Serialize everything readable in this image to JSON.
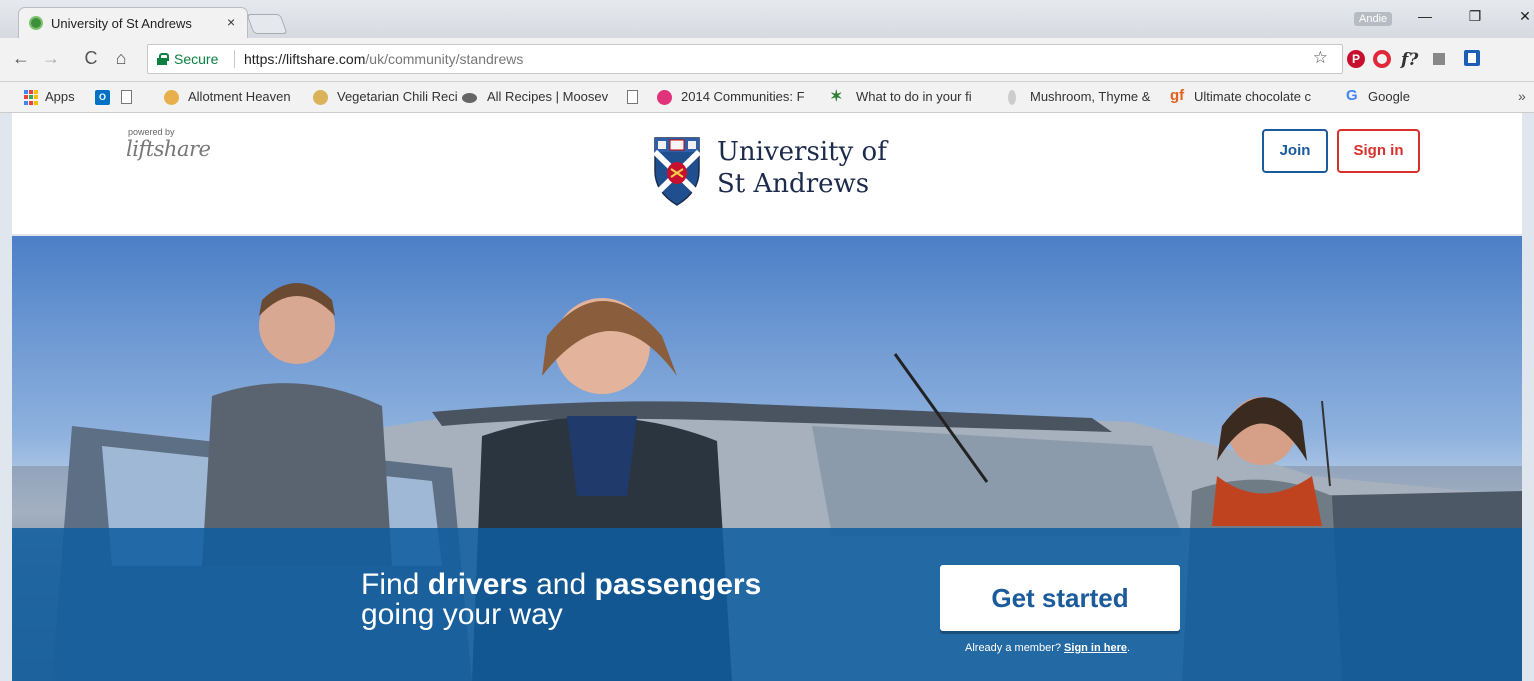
{
  "browser": {
    "tab": {
      "title": "University of St Andrews",
      "close": "×"
    },
    "profile": "Andie",
    "window_controls": {
      "minimize": "—",
      "restore": "❐",
      "close": "✕"
    },
    "nav": {
      "back": "←",
      "forward": "→",
      "reload": "C",
      "home": "⌂"
    },
    "omnibox": {
      "secure_label": "Secure",
      "url_host": "https://liftshare.com",
      "url_path": "/uk/community/standrews"
    },
    "bookmarks": [
      {
        "label": "Apps"
      },
      {
        "label": "Allotment Heaven"
      },
      {
        "label": "Vegetarian Chili Reci"
      },
      {
        "label": "All Recipes | Moosev"
      },
      {
        "label": "2014 Communities: F"
      },
      {
        "label": "What to do in your fi"
      },
      {
        "label": "Mushroom, Thyme &"
      },
      {
        "label": "Ultimate chocolate c"
      },
      {
        "label": "Google"
      }
    ],
    "bookmarks_more": "»",
    "extension_f_label": "f?",
    "bookmark_icon_text": {
      "outlook": "O",
      "gf": "gf",
      "google": "G"
    },
    "accent_colors": {
      "secure": "#0b8043",
      "pinterest": "#c8102e",
      "opera": "#e0283a"
    }
  },
  "header": {
    "powered_by": "powered by",
    "powered_logo": "liftshare",
    "university_line1": "University of",
    "university_line2": "St Andrews",
    "join_label": "Join",
    "signin_label": "Sign in"
  },
  "hero": {
    "tagline_find": "Find ",
    "tagline_drivers": "drivers",
    "tagline_and": " and ",
    "tagline_passengers": "passengers",
    "tagline_line2": "going your way",
    "cta_label": "Get started",
    "already_text": "Already a member? ",
    "signin_link": "Sign in here",
    "already_end": "."
  },
  "colors": {
    "brand_blue": "#1b5a9b",
    "signin_red": "#d9302c",
    "band_blue": "#0e5da0"
  }
}
